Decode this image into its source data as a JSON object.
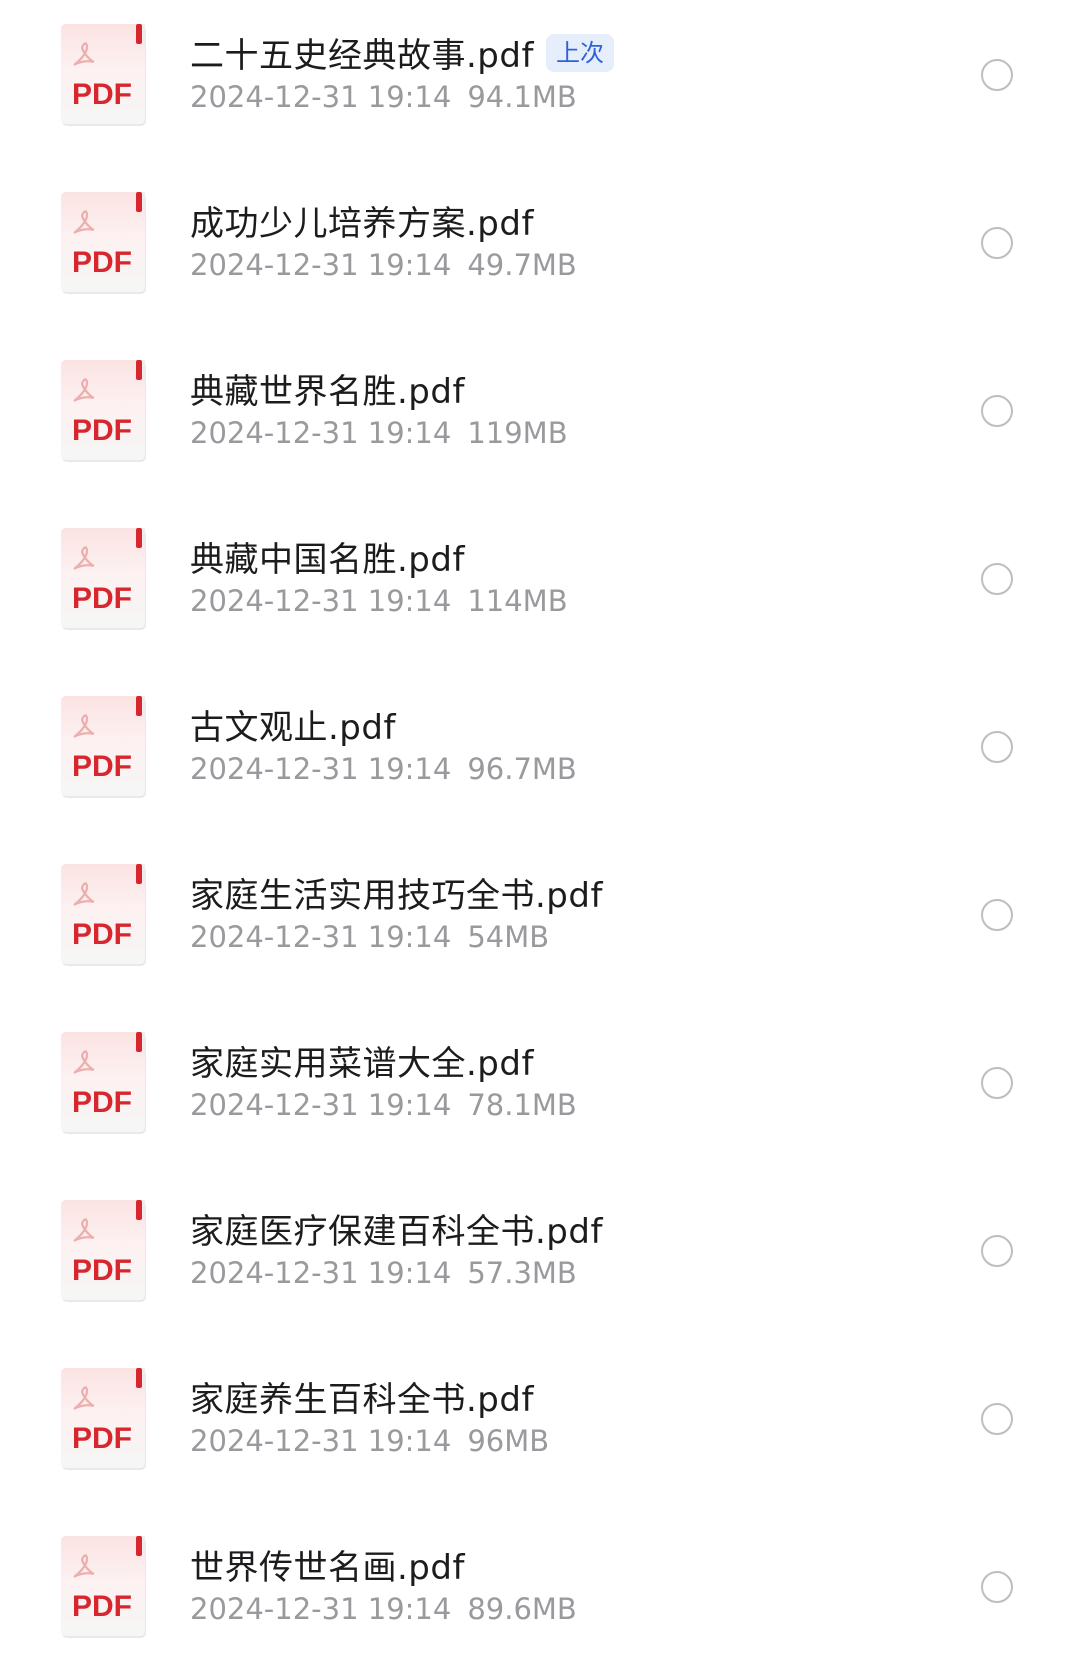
{
  "files": [
    {
      "name": "二十五史经典故事.pdf",
      "date": "2024-12-31 19:14",
      "size": "94.1MB",
      "badge": "上次",
      "icon": "pdf-file-icon",
      "icon_text": "PDF"
    },
    {
      "name": "成功少儿培养方案.pdf",
      "date": "2024-12-31 19:14",
      "size": "49.7MB",
      "badge": null,
      "icon": "pdf-file-icon",
      "icon_text": "PDF"
    },
    {
      "name": "典藏世界名胜.pdf",
      "date": "2024-12-31 19:14",
      "size": "119MB",
      "badge": null,
      "icon": "pdf-file-icon",
      "icon_text": "PDF"
    },
    {
      "name": "典藏中国名胜.pdf",
      "date": "2024-12-31 19:14",
      "size": "114MB",
      "badge": null,
      "icon": "pdf-file-icon",
      "icon_text": "PDF"
    },
    {
      "name": "古文观止.pdf",
      "date": "2024-12-31 19:14",
      "size": "96.7MB",
      "badge": null,
      "icon": "pdf-file-icon",
      "icon_text": "PDF"
    },
    {
      "name": "家庭生活实用技巧全书.pdf",
      "date": "2024-12-31 19:14",
      "size": "54MB",
      "badge": null,
      "icon": "pdf-file-icon",
      "icon_text": "PDF"
    },
    {
      "name": "家庭实用菜谱大全.pdf",
      "date": "2024-12-31 19:14",
      "size": "78.1MB",
      "badge": null,
      "icon": "pdf-file-icon",
      "icon_text": "PDF"
    },
    {
      "name": "家庭医疗保建百科全书.pdf",
      "date": "2024-12-31 19:14",
      "size": "57.3MB",
      "badge": null,
      "icon": "pdf-file-icon",
      "icon_text": "PDF"
    },
    {
      "name": "家庭养生百科全书.pdf",
      "date": "2024-12-31 19:14",
      "size": "96MB",
      "badge": null,
      "icon": "pdf-file-icon",
      "icon_text": "PDF"
    },
    {
      "name": "世界传世名画.pdf",
      "date": "2024-12-31 19:14",
      "size": "89.6MB",
      "badge": null,
      "icon": "pdf-file-icon",
      "icon_text": "PDF"
    }
  ],
  "colors": {
    "pdf_red": "#d8262e",
    "badge_text": "#2e62d9",
    "badge_bg": "#e6eefc",
    "meta_gray": "#9a9a9e"
  }
}
